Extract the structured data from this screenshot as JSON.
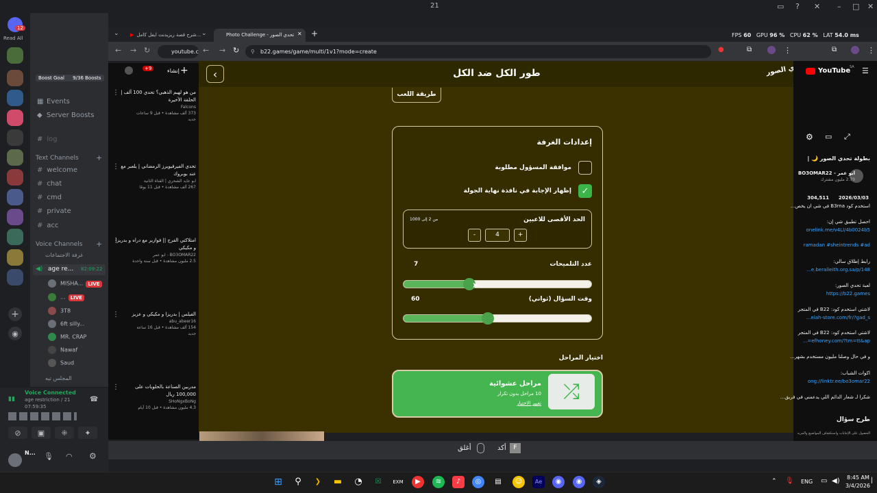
{
  "titlebar": {
    "title": "21"
  },
  "discord": {
    "read_all": "Read All",
    "badge_count": "12",
    "webcam_count": "21",
    "boost_goal": "Boost Goal",
    "boost_progress": "9/36 Boosts",
    "events": "Events",
    "server_boosts": "Server Boosts",
    "log": "log",
    "text_channels_header": "Text Channels",
    "text_channels": [
      "welcome",
      "chat",
      "cmd",
      "private",
      "acc"
    ],
    "voice_channels_header": "Voice Channels",
    "voice_channel_1": "غرفة الاجتماعات",
    "active_voice": "age re...",
    "active_voice_time": "82:09:22",
    "voice_users": [
      {
        "name": "MISHA...",
        "live": "LIVE"
      },
      {
        "name": "...",
        "live": "LIVE"
      },
      {
        "name": "3T8",
        "live": ""
      },
      {
        "name": "6ft silly...",
        "live": ""
      },
      {
        "name": "MR. CRAP",
        "live": ""
      },
      {
        "name": "Nawaf",
        "live": ""
      },
      {
        "name": "Saud",
        "live": ""
      }
    ],
    "voice_channel_2": "المجلس تيه",
    "voice_connected": "Voice Connected",
    "voice_channel_status": "age restriction / 21",
    "voice_time": "07:59:35",
    "username": "N..."
  },
  "yt_left": {
    "header_add": "إنشاء",
    "notif_count": "+9",
    "items": [
      {
        "title": "من هو لهيم الذهبي؟ تحدي 100 ألف | الحلقة الأخيرة",
        "channel": "Falcons",
        "meta": "373 ألف مشاهدة • قبل 9 ساعات",
        "tag": "جديد"
      },
      {
        "title": "تحدي الفيرفيويرز الرمضاني | يلعبر مع عند بوبروك",
        "channel": "ابو عايد الشحري | القناة الثانية",
        "meta": "267 ألف مشاهدة • قبل 11 يومًا",
        "tag": ""
      },
      {
        "title": "امتلاكتي الفرج || فوازير مع دراه و بدريزا و مكيكي",
        "channel": "BO3OMAR22 - ابو عمر",
        "meta": "2.5 مليون مشاهدة • قبل سنة واحدة",
        "tag": ""
      },
      {
        "title": "الفيلس | بدريزا و مكيكي و عزيز",
        "channel": "abu_abeer16",
        "meta": "154 ألف مشاهدة • قبل 16 ساعة",
        "tag": "جديد"
      },
      {
        "title": "مدربين الصناعة بالحلويات على 100,000 ريال",
        "channel": "SHoNgxBoNg",
        "meta": "4.3 مليون مشاهدة • قبل 10 أيام",
        "tag": ""
      }
    ]
  },
  "browser": {
    "tab1": "شرح قصة ريزيدنت ايفل كامل...",
    "tab2": "Photo Challenge - تحدي الصور",
    "url_left": "youtube.com",
    "url": "b22.games/game/multi/1v1?mode=create",
    "fps_label": "FPS",
    "fps_value": "60",
    "gpu_label": "GPU",
    "gpu_value": "96 %",
    "cpu_label": "CPU",
    "cpu_value": "62 %",
    "lat_label": "LAT",
    "lat_value": "54.0 ms"
  },
  "game": {
    "title": "طور الكل ضد الكل",
    "logo": "تحدي الصور",
    "mode_button": "طريقة اللعب",
    "settings_title": "إعدادات الغرفة",
    "opt_admin_approval": "موافقة المسؤول مطلوبة",
    "opt_show_answer": "إظهار الإجابة في نافذة نهاية الجولة",
    "max_players_label": "الحد الأقصى للاعبين",
    "max_players_range": "من 2 إلى 1000",
    "max_players_value": "4",
    "minus": "-",
    "plus": "+",
    "hints_label": "عدد التلميحات",
    "hints_value": "7",
    "hints_fraction": 0.35,
    "time_label": "وقت السؤال (ثواني)",
    "time_value": "60",
    "time_fraction": 0.45,
    "stages_label": "اختيار المراحل",
    "stage_title": "مراحل عشوائية",
    "stage_sub": "10 مراحل بدون تكرار",
    "stage_change": "تغيير الاختيار",
    "bottom_close": "أغلق",
    "bottom_confirm": "أكد",
    "key_f": "F"
  },
  "yt_right": {
    "youtube": "YouTube",
    "yt_region": "SA",
    "video_title": "بطولة تحدي الصور 🌙 |",
    "channel": "ابو عمر - BO3OMAR22",
    "subs": "2.79 مليون مشترك",
    "views": "304,511",
    "date": "2026/03/03",
    "code_line": "استخدم كود B3rna في شي ان يخص...",
    "app_line": "احصل تطبيق شي إن:",
    "link1": "onelink.me/v4Ll/4b0024b5",
    "tags": "ramadan #sheintrends #ad",
    "store_line": "رابط إطلاق سالي:",
    "link2": "e.beralleith.org.sa/p/148...",
    "challenge_line": "لعبة تحدي الصور:",
    "link3": "https://b22.games",
    "code2": "لاشتي استخدم كود: B22 في المتجر",
    "link4": "elah-store.com/fr/?gad_s...",
    "code3": "لاشتي استخدم كود: B22 في المتجر",
    "link5": "efhoney.com/?tm=tt&ap=...",
    "more1": "و في حال وصلنا مليون مستخدم بشهر...",
    "accounts": "اكوات الشباب:",
    "link6": "ong://linktr.ee/bo3omar22",
    "thanks": "شكرا لـ شعار الدائم اللي يدعمني في فريق...",
    "ask": "طرح سؤال",
    "ask_sub": "الحصول على الإجابات واستكشاف المواضيع والمزيد"
  },
  "taskbar": {
    "lang": "ENG",
    "time": "8:45 AM",
    "date": "3/4/2026"
  }
}
